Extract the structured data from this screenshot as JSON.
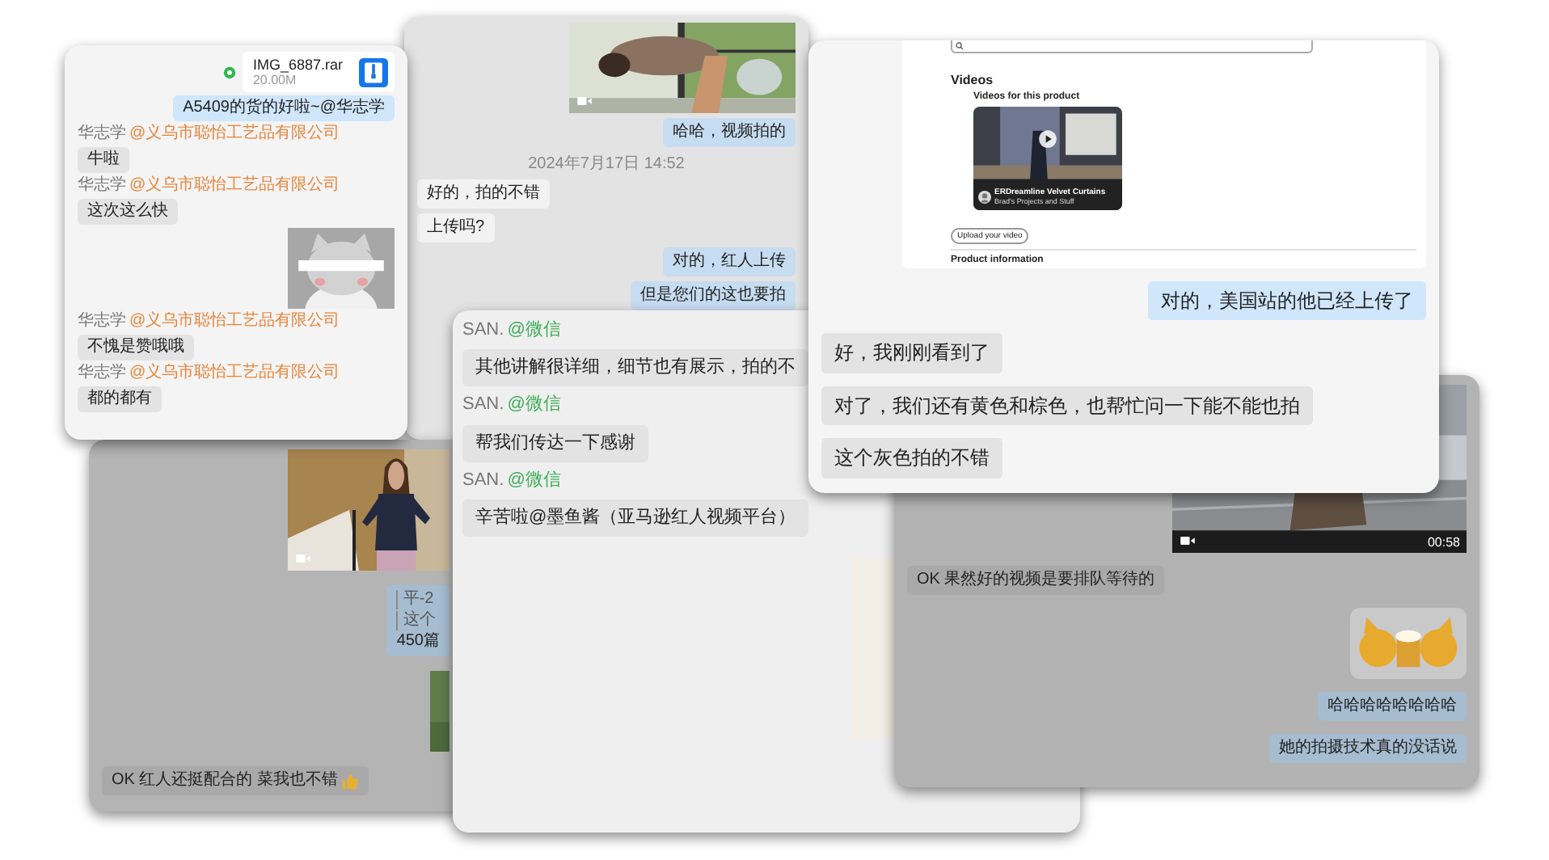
{
  "cards": [
    {
      "messages": [
        {
          "kind": "file",
          "name": "IMG_6887.rar",
          "size": "20.00M"
        },
        {
          "kind": "sent",
          "text": "A5409的货的好啦~@华志学"
        },
        {
          "kind": "received",
          "sender": "华志学",
          "company": "@义乌市聪怡工艺品有限公司",
          "text": "牛啦"
        },
        {
          "kind": "received",
          "sender": "华志学",
          "company": "@义乌市聪怡工艺品有限公司",
          "text": "这次这么快"
        },
        {
          "kind": "picture"
        },
        {
          "kind": "received",
          "sender": "华志学",
          "company": "@义乌市聪怡工艺品有限公司",
          "text": "不愧是赞哦哦"
        },
        {
          "kind": "received",
          "sender": "华志学",
          "company": "@义乌市聪怡工艺品有限公司",
          "text": "都的都有"
        }
      ]
    },
    {
      "messages": [
        {
          "kind": "video"
        },
        {
          "kind": "sent",
          "text": "哈哈，视频拍的"
        },
        {
          "kind": "time",
          "text": "2024年7月17日 14:52"
        },
        {
          "kind": "received",
          "text": "好的，拍的不错"
        },
        {
          "kind": "received",
          "text": "上传吗?"
        },
        {
          "kind": "sent",
          "text": "对的，红人上传"
        },
        {
          "kind": "sent",
          "text": "但是您们的这也要拍"
        }
      ]
    },
    {
      "messages": [
        {
          "kind": "screenshot",
          "heading": "Videos",
          "subheading": "Videos for this product",
          "video_title": "ERDreamline Velvet Curtains",
          "video_channel": "Brad's Projects and Stuff",
          "button": "Upload your video",
          "section": "Product information"
        },
        {
          "kind": "sent",
          "text": "对的，美国站的他已经上传了"
        },
        {
          "kind": "received",
          "text": "好，我刚刚看到了"
        },
        {
          "kind": "received",
          "text": "对了，我们还有黄色和棕色，也帮忙问一下能不能也拍"
        },
        {
          "kind": "received",
          "text": "这个灰色拍的不错"
        }
      ]
    },
    {
      "messages": [
        {
          "kind": "received",
          "sender": "SAN.",
          "company": "@微信",
          "text": "其他讲解很详细，细节也有展示，拍的不"
        },
        {
          "kind": "received",
          "sender": "SAN.",
          "company": "@微信",
          "text": "帮我们传达一下感谢"
        },
        {
          "kind": "received",
          "sender": "SAN.",
          "company": "@微信",
          "text": "辛苦啦@墨鱼酱（亚马逊红人视频平台）"
        },
        {
          "kind": "picture"
        }
      ]
    },
    {
      "messages": [
        {
          "kind": "video"
        },
        {
          "kind": "quote",
          "lines": [
            "平-2",
            "这个"
          ],
          "text": "450篇"
        },
        {
          "kind": "picture"
        },
        {
          "kind": "received",
          "text": "OK 红人还挺配合的 菜我也不错",
          "thumbs_up": true
        }
      ]
    },
    {
      "messages": [
        {
          "kind": "video",
          "duration": "00:58"
        },
        {
          "kind": "received",
          "text": "OK 果然好的视频是要排队等待的"
        },
        {
          "kind": "picture"
        },
        {
          "kind": "sent",
          "text": "哈哈哈哈哈哈哈哈"
        },
        {
          "kind": "sent",
          "text": "她的拍摄技术真的没话说"
        }
      ]
    }
  ]
}
